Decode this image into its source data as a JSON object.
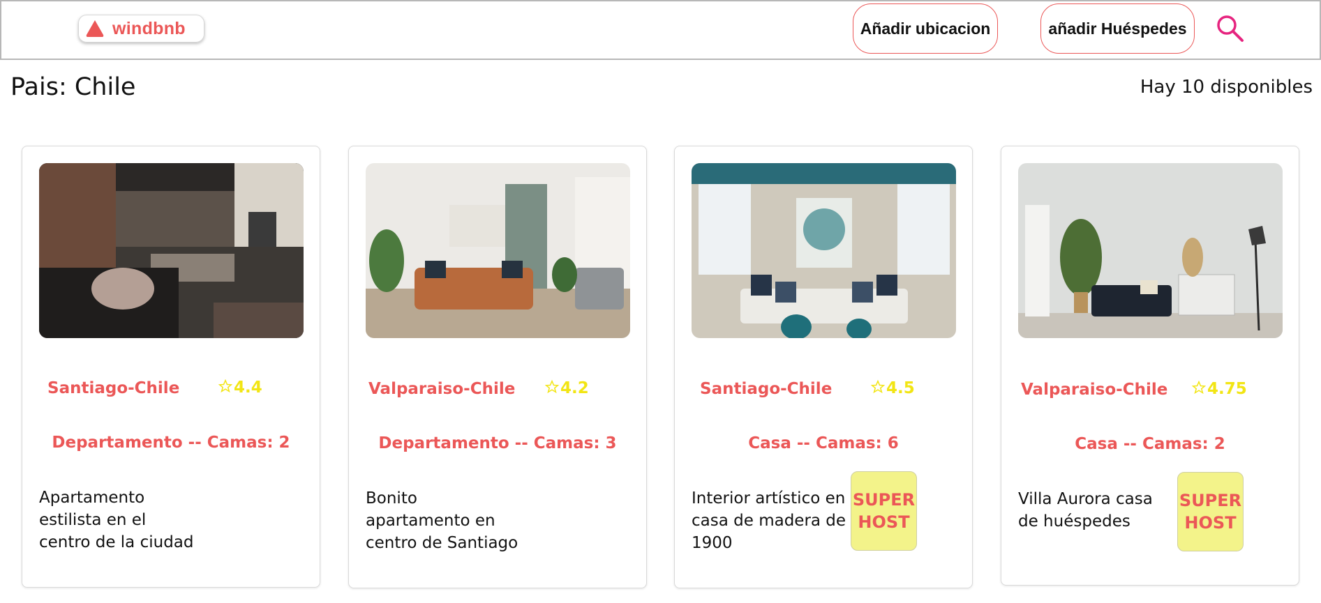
{
  "header": {
    "logo_text": "windbnb",
    "location_button": "Añadir ubicacion",
    "guests_button": "añadir Huéspedes",
    "search_icon": "search-icon",
    "accent_color": "#eb5757"
  },
  "main": {
    "country_label": "Pais: Chile",
    "available_label": "Hay 10 disponibles"
  },
  "cards": [
    {
      "city": "Santiago-Chile",
      "rating": "4.4",
      "type_label": "Departamento -- Camas: 2",
      "description": "Apartamento estilista en el centro de la ciudad",
      "superhost": false
    },
    {
      "city": "Valparaiso-Chile",
      "rating": "4.2",
      "type_label": "Departamento -- Camas: 3",
      "description": "Bonito apartamento en centro de Santiago",
      "superhost": false
    },
    {
      "city": "Santiago-Chile",
      "rating": "4.5",
      "type_label": "Casa -- Camas: 6",
      "description": "Interior artístico en casa de madera de 1900",
      "superhost": true,
      "superhost_line1": "SUPER",
      "superhost_line2": "HOST"
    },
    {
      "city": "Valparaiso-Chile",
      "rating": "4.75",
      "type_label": "Casa -- Camas: 2",
      "description": "Villa Aurora casa de huéspedes",
      "superhost": true,
      "superhost_line1": "SUPER",
      "superhost_line2": "HOST"
    }
  ],
  "colors": {
    "accent": "#eb5757",
    "rating": "#f2e514",
    "superhost_bg": "#f3f38a"
  }
}
